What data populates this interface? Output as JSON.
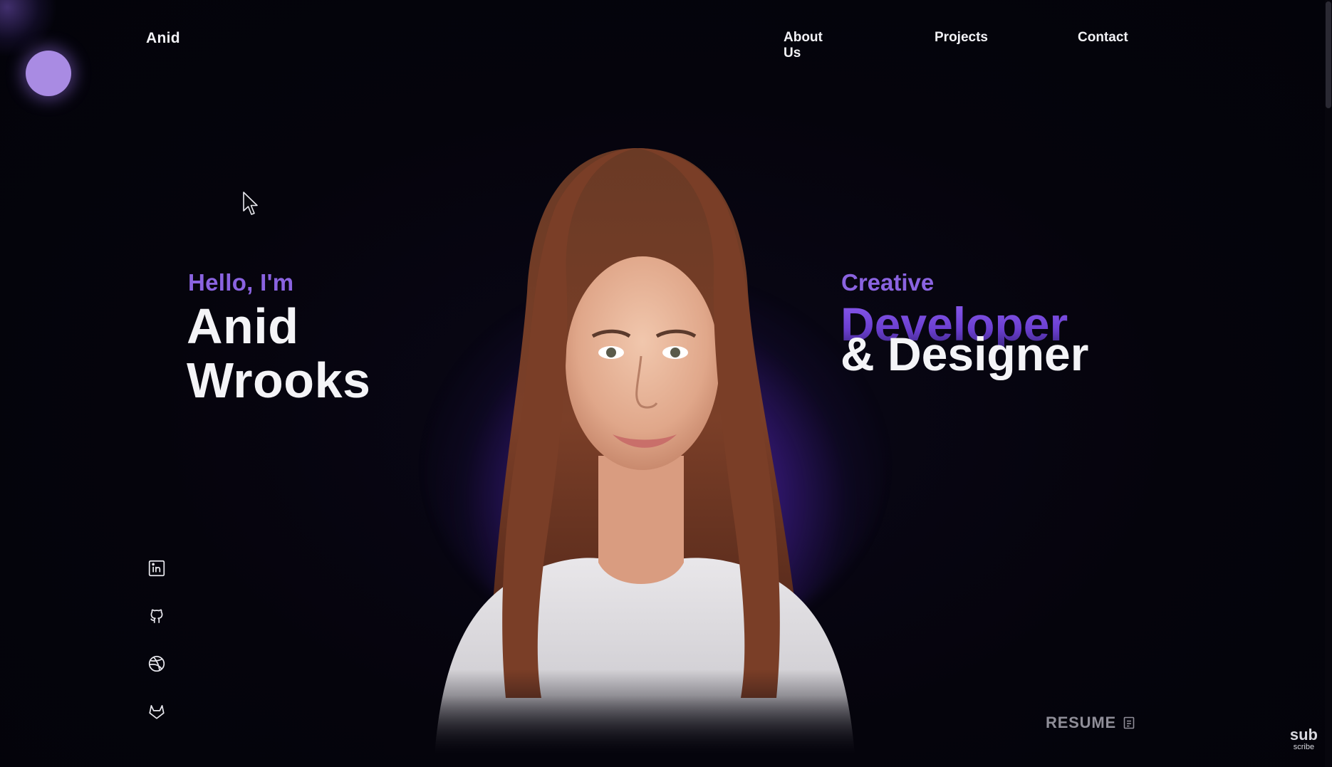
{
  "brand": {
    "name": "Anid"
  },
  "nav": {
    "items": [
      {
        "label": "About Us"
      },
      {
        "label": "Projects"
      },
      {
        "label": "Contact"
      }
    ]
  },
  "hero": {
    "greeting": "Hello, I'm",
    "first_name": "Anid",
    "last_name": "Wrooks",
    "role_prefix": "Creative",
    "role_primary": "Developer",
    "role_secondary": "& Designer"
  },
  "socials": {
    "items": [
      {
        "icon": "linkedin-icon"
      },
      {
        "icon": "github-icon"
      },
      {
        "icon": "dribbble-icon"
      },
      {
        "icon": "gitlab-icon"
      }
    ]
  },
  "resume": {
    "label": "RESUME",
    "icon": "document-icon"
  },
  "subscribe": {
    "line1": "sub",
    "line2": "scribe"
  },
  "colors": {
    "accent": "#8a63e0",
    "background": "#05040c",
    "text": "#f4f4f7",
    "muted": "#8f8e98",
    "orb": "#a98be3"
  }
}
